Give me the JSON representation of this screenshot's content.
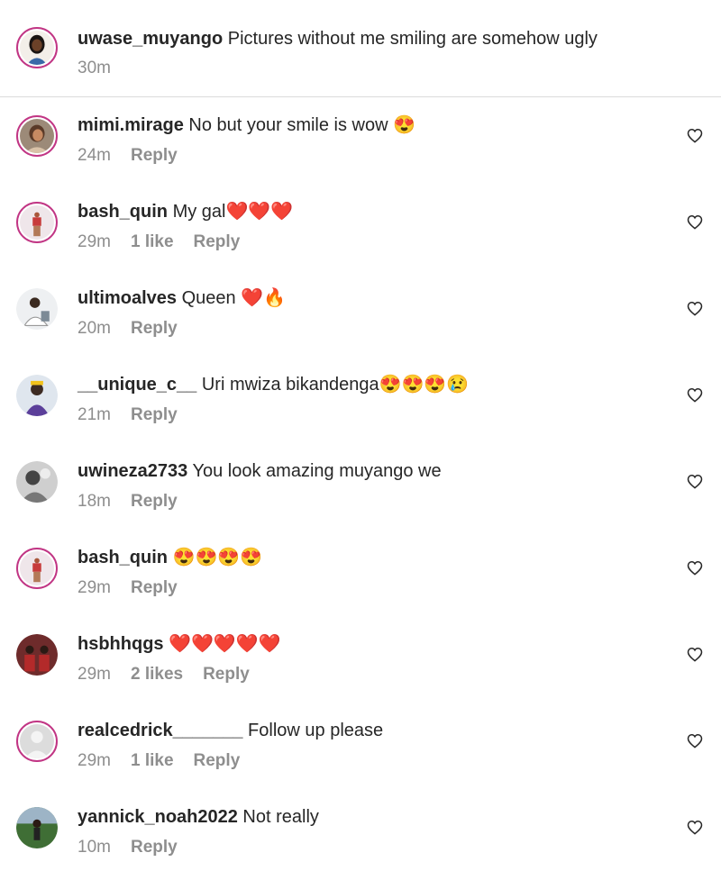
{
  "caption": {
    "username": "uwase_muyango",
    "text": "Pictures without me smiling are somehow ugly",
    "time": "30m"
  },
  "reply_label": "Reply",
  "icons": {
    "like": "heart-outline-icon",
    "smiling_face_with_heart_eyes": "😍",
    "red_heart": "❤️",
    "fire": "🔥",
    "crying_face": "😢"
  },
  "colors": {
    "text": "#262626",
    "meta": "#8e8e8e",
    "story_ring": "#c13584",
    "divider": "#dbdbdb"
  },
  "comments": [
    {
      "username": "mimi.mirage",
      "text": "No but your smile is wow 😍",
      "time": "24m",
      "likes": ""
    },
    {
      "username": "bash_quin",
      "text": "My gal❤️❤️❤️",
      "time": "29m",
      "likes": "1 like"
    },
    {
      "username": "ultimoalves",
      "text": "Queen ❤️🔥",
      "time": "20m",
      "likes": ""
    },
    {
      "username": "__unique_c__",
      "text": "Uri mwiza bikandenga😍😍😍😢",
      "time": "21m",
      "likes": ""
    },
    {
      "username": "uwineza2733",
      "text": "You look amazing muyango we",
      "time": "18m",
      "likes": ""
    },
    {
      "username": "bash_quin",
      "text": "😍😍😍😍",
      "time": "29m",
      "likes": ""
    },
    {
      "username": "hsbhhqgs",
      "text": "❤️❤️❤️❤️❤️",
      "time": "29m",
      "likes": "2 likes"
    },
    {
      "username": "realcedrick_______",
      "text": "Follow up please",
      "time": "29m",
      "likes": "1 like"
    },
    {
      "username": "yannick_noah2022",
      "text": "Not really",
      "time": "10m",
      "likes": ""
    }
  ]
}
